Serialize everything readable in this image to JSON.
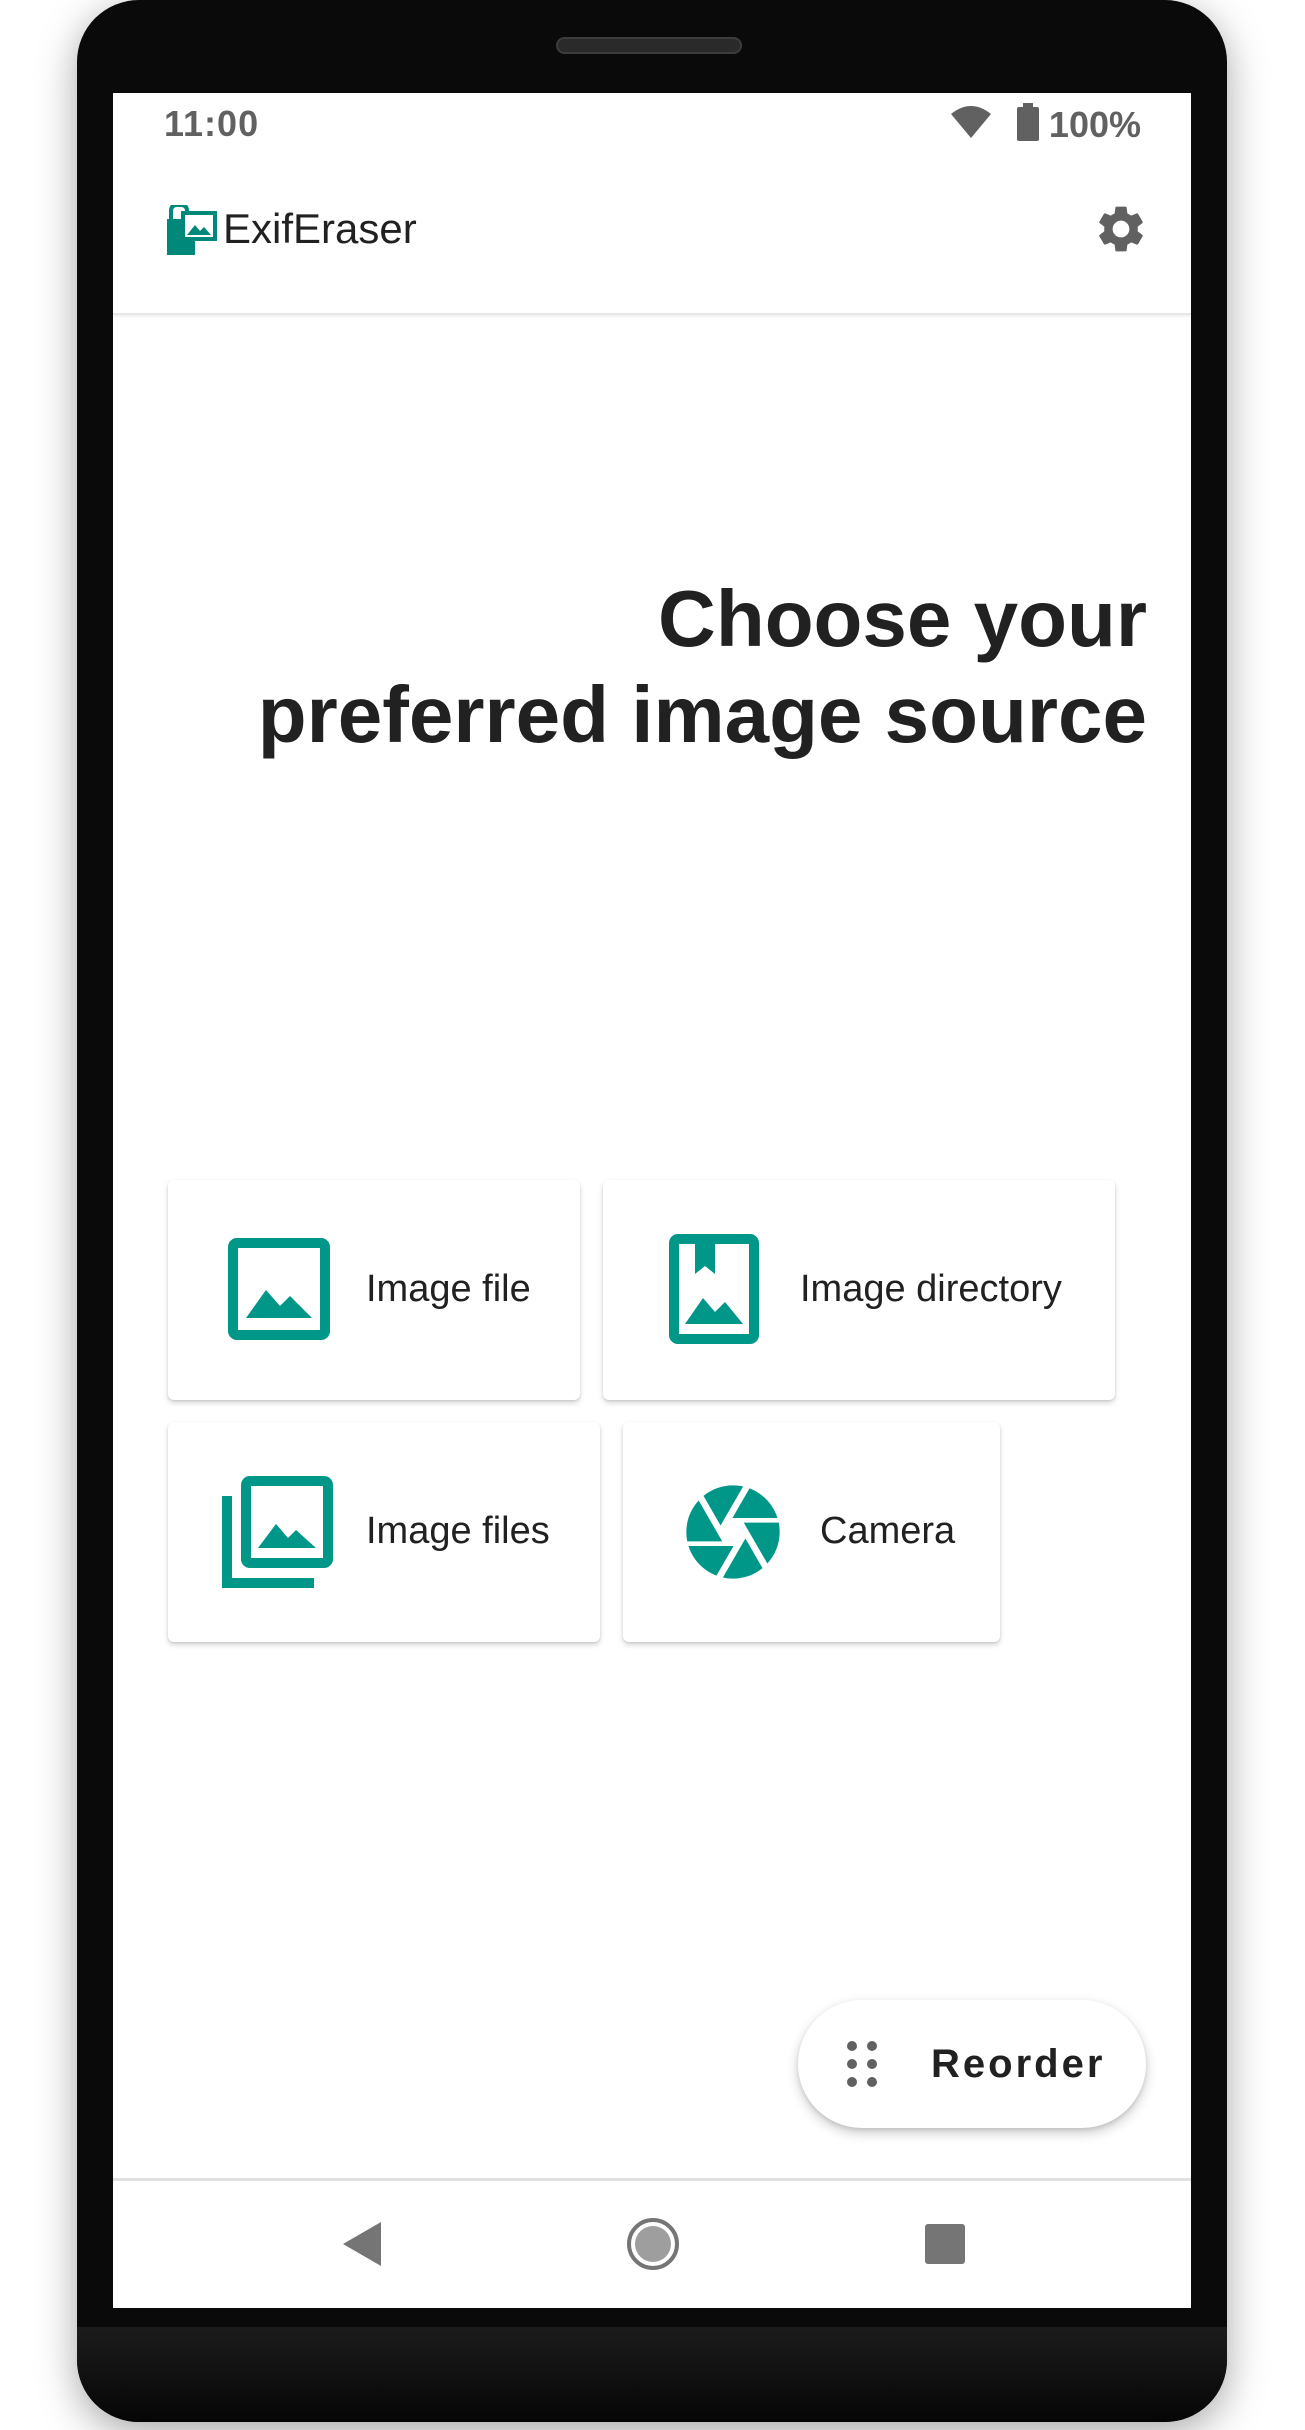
{
  "status_bar": {
    "time": "11:00",
    "battery": "100%",
    "wifi_icon": "wifi-icon",
    "battery_icon": "battery-icon"
  },
  "app_bar": {
    "title": "ExifEraser",
    "logo_icon": "app-logo-icon",
    "settings_icon": "gear-icon"
  },
  "headline": {
    "line1": "Choose your",
    "line2": "preferred image source"
  },
  "sources": [
    {
      "label": "Image file",
      "icon": "image-icon"
    },
    {
      "label": "Image directory",
      "icon": "image-directory-icon"
    },
    {
      "label": "Image files",
      "icon": "image-stack-icon"
    },
    {
      "label": "Camera",
      "icon": "camera-aperture-icon"
    }
  ],
  "fab": {
    "label": "Reorder",
    "icon": "drag-handle-icon"
  },
  "nav_bar": {
    "back_icon": "back-icon",
    "home_icon": "home-icon",
    "recents_icon": "recents-icon"
  },
  "colors": {
    "accent": "#009688",
    "text": "#212121",
    "icon_grey": "#616161"
  }
}
